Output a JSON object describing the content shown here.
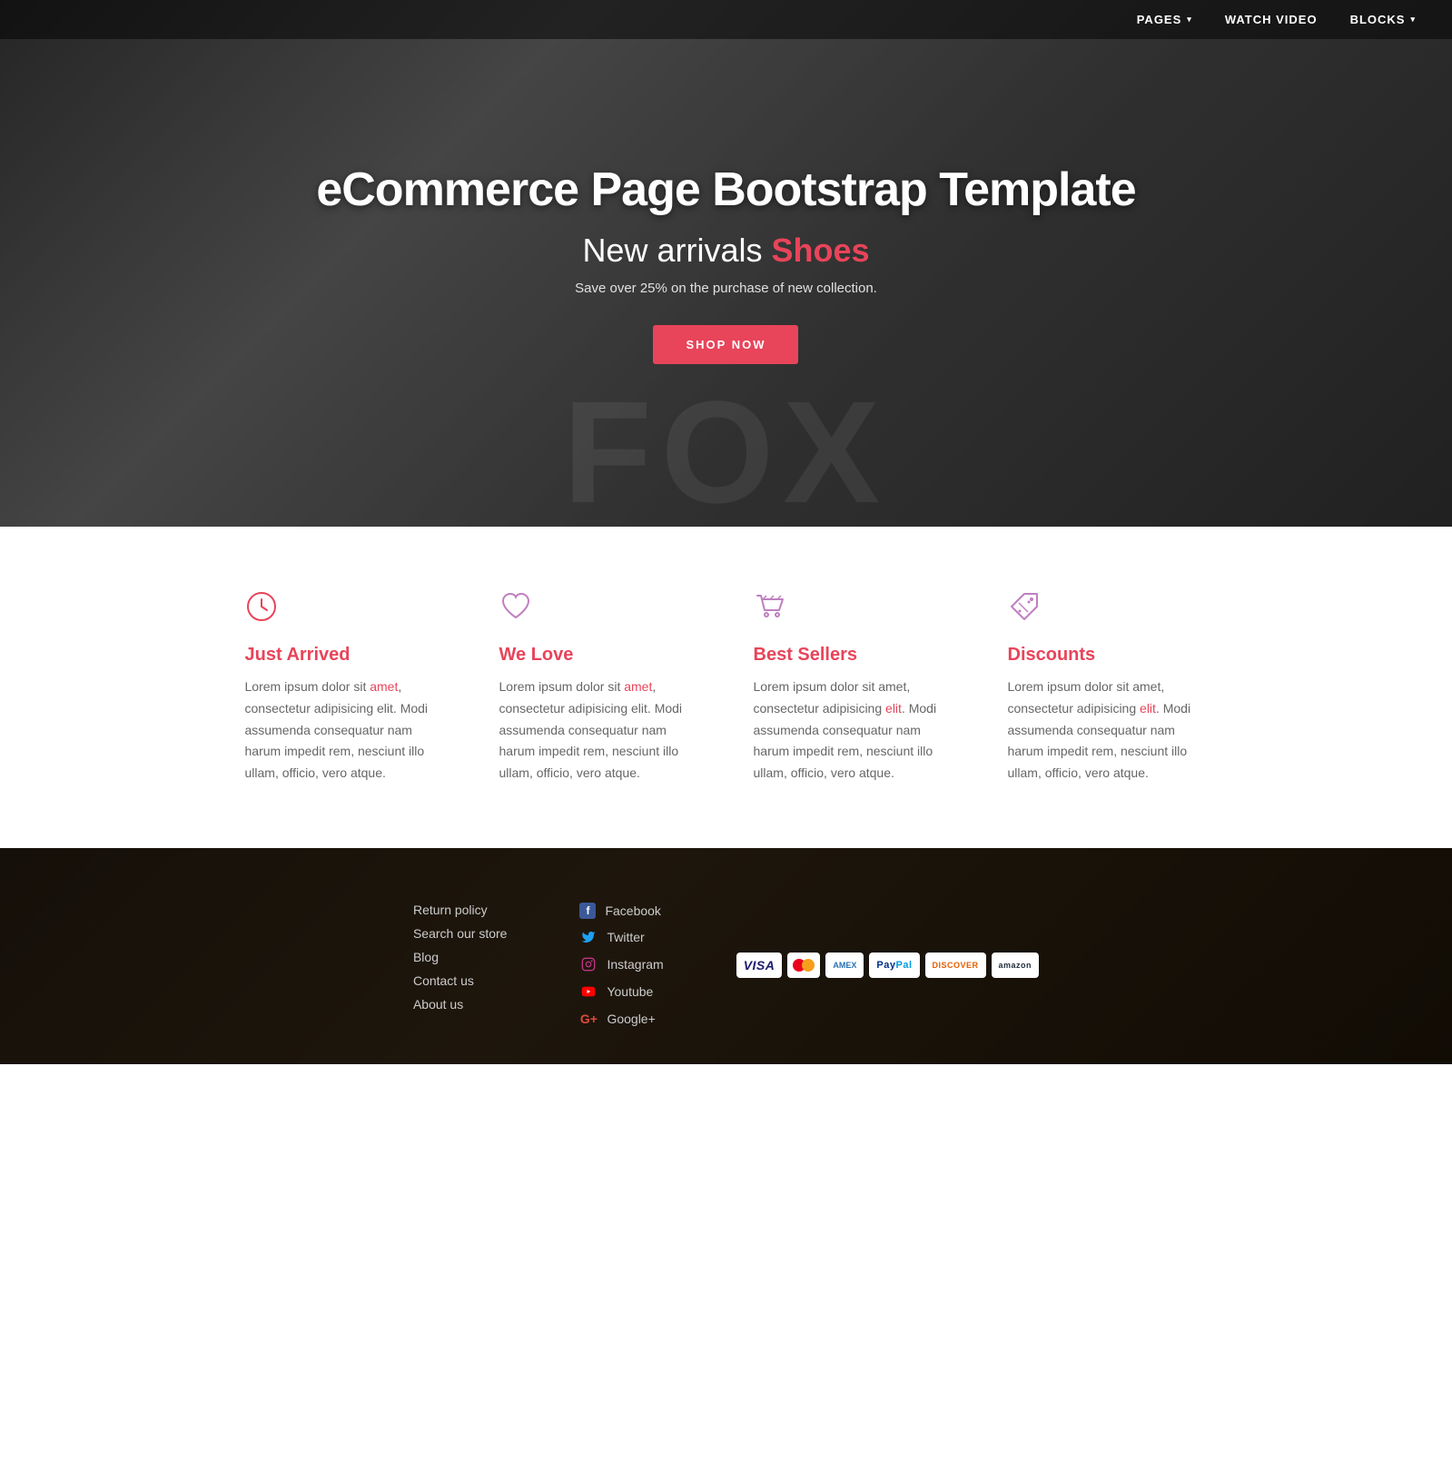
{
  "navbar": {
    "items": [
      {
        "id": "pages",
        "label": "PAGES",
        "has_dropdown": true
      },
      {
        "id": "watch-video",
        "label": "WATCH VIDEO",
        "has_dropdown": false
      },
      {
        "id": "blocks",
        "label": "BLOCKS",
        "has_dropdown": true
      }
    ]
  },
  "hero": {
    "title": "eCommerce Page Bootstrap Template",
    "subtitle_prefix": "New arrivals ",
    "subtitle_accent": "Shoes",
    "description": "Save over 25% on the purchase of new collection.",
    "cta_label": "SHOP NOW",
    "watermark": "FOX"
  },
  "features": [
    {
      "id": "just-arrived",
      "icon": "🕐",
      "icon_type": "clock",
      "title": "Just Arrived",
      "text": "Lorem ipsum dolor sit amet, consectetur adipisicing elit. Modi assumenda consequatur nam harum impedit rem, nesciunt illo ullam, officio, vero atque.",
      "link_word": "amet",
      "link_type": "red"
    },
    {
      "id": "we-love",
      "icon": "♡",
      "icon_type": "heart",
      "title": "We Love",
      "text": "Lorem ipsum dolor sit amet, consectetur adipisicing elit. Modi assumenda consequatur nam harum impedit rem, nesciunt illo ullam, officio, vero atque.",
      "link_word": "amet",
      "link_type": "red"
    },
    {
      "id": "best-sellers",
      "icon": "🛒",
      "icon_type": "cart",
      "title": "Best Sellers",
      "text": "Lorem ipsum dolor sit amet, consectetur adipisicing elit. Modi assumenda consequatur nam harum impedit rem, nesciunt illo ullam, officio, vero atque.",
      "link_word": "elit",
      "link_type": "red"
    },
    {
      "id": "discounts",
      "icon": "🏷",
      "icon_type": "tag",
      "title": "Discounts",
      "text": "Lorem ipsum dolor sit amet, consectetur adipisicing elit. Modi assumenda consequatur nam harum impedit rem, nesciunt illo ullam, officio, vero atque.",
      "link_word": "elit",
      "link_type": "red"
    }
  ],
  "footer": {
    "links": [
      {
        "id": "return-policy",
        "label": "Return policy"
      },
      {
        "id": "search-store",
        "label": "Search our store"
      },
      {
        "id": "blog",
        "label": "Blog"
      },
      {
        "id": "contact-us",
        "label": "Contact us"
      },
      {
        "id": "about-us",
        "label": "About us"
      }
    ],
    "social": [
      {
        "id": "facebook",
        "label": "Facebook",
        "icon": "f",
        "color": "#3b5998"
      },
      {
        "id": "twitter",
        "label": "Twitter",
        "icon": "t",
        "color": "#1da1f2"
      },
      {
        "id": "instagram",
        "label": "Instagram",
        "icon": "i",
        "color": "#c13584"
      },
      {
        "id": "youtube",
        "label": "Youtube",
        "icon": "y",
        "color": "#ff0000"
      },
      {
        "id": "googleplus",
        "label": "Google+",
        "icon": "g",
        "color": "#dd4b39"
      }
    ],
    "payment_methods": [
      "VISA",
      "Mastercard",
      "AMEX",
      "PayPal",
      "DISCOVER",
      "amazon"
    ]
  },
  "colors": {
    "accent": "#e8445a",
    "purple": "#c07fc0",
    "hero_overlay": "rgba(0,0,0,0.4)"
  }
}
